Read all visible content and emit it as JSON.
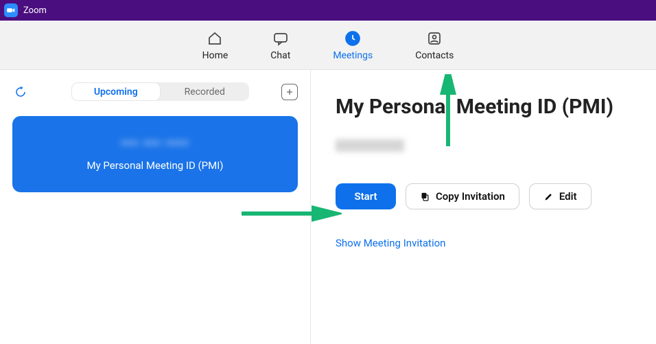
{
  "titlebar": {
    "app_name": "Zoom"
  },
  "tabs": {
    "home": {
      "label": "Home"
    },
    "chat": {
      "label": "Chat"
    },
    "meetings": {
      "label": "Meetings"
    },
    "contacts": {
      "label": "Contacts"
    }
  },
  "left": {
    "segments": {
      "upcoming": "Upcoming",
      "recorded": "Recorded"
    },
    "card": {
      "pmi_number": "••• ••• ••••",
      "label": "My Personal Meeting ID (PMI)"
    }
  },
  "right": {
    "title": "My Personal Meeting ID (PMI)",
    "start": "Start",
    "copy": "Copy Invitation",
    "edit": "Edit",
    "show_invitation": "Show Meeting Invitation"
  }
}
